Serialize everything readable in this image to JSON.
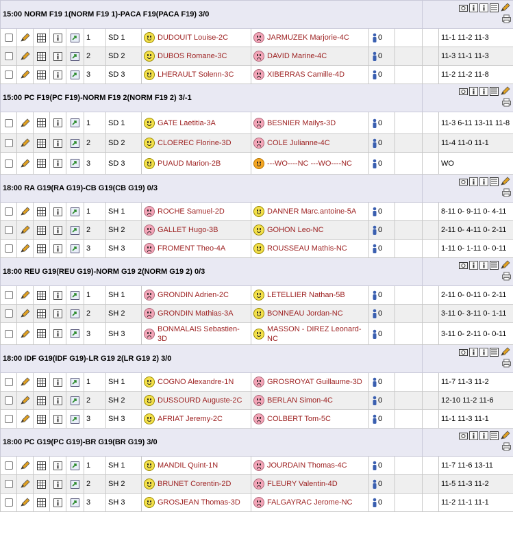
{
  "colors": {
    "header_bg": "#e9e9f3",
    "alt_row": "#efefef",
    "player_text": "#9c1f1f"
  },
  "icons": [
    "checkbox",
    "pencil-icon",
    "grid-icon",
    "info-icon",
    "export-icon",
    "happy-face-icon",
    "sad-face-icon",
    "umpire-icon",
    "stats-icon",
    "print-icon"
  ],
  "ties": [
    {
      "title": "15:00 NORM F19 1(NORM F19 1)-PACA F19(PACA F19)  3/0",
      "matches": [
        {
          "num": "1",
          "type": "SD 1",
          "p1": "DUDOUIT Louise-2C",
          "p1_face": "happy",
          "p2": "JARMUZEK Marjorie-4C",
          "p2_face": "sad",
          "ump": "0",
          "score": "11-1 11-2 11-3"
        },
        {
          "num": "2",
          "type": "SD 2",
          "p1": "DUBOS Romane-3C",
          "p1_face": "happy",
          "p2": "DAVID Marine-4C",
          "p2_face": "sad",
          "ump": "0",
          "score": "11-3 11-1 11-3"
        },
        {
          "num": "3",
          "type": "SD 3",
          "p1": "LHERAULT Solenn-3C",
          "p1_face": "happy",
          "p2": "XIBERRAS Camille-4D",
          "p2_face": "sad",
          "ump": "0",
          "score": "11-2 11-2 11-8"
        }
      ]
    },
    {
      "title": "15:00 PC F19(PC F19)-NORM F19 2(NORM F19 2)  3/-1",
      "matches": [
        {
          "num": "1",
          "type": "SD 1",
          "p1": "GATE Laetitia-3A",
          "p1_face": "happy",
          "p2": "BESNIER Mailys-3D",
          "p2_face": "sad",
          "ump": "0",
          "score": "11-3 6-11 13-11 11-8",
          "tall": true
        },
        {
          "num": "2",
          "type": "SD 2",
          "p1": "CLOEREC Florine-3D",
          "p1_face": "happy",
          "p2": "COLE Julianne-4C",
          "p2_face": "sad",
          "ump": "0",
          "score": "11-4 11-0 11-1"
        },
        {
          "num": "3",
          "type": "SD 3",
          "p1": "PUAUD Marion-2B",
          "p1_face": "happy",
          "p2": "---WO----NC ---WO----NC",
          "p2_face": "wo",
          "ump": "0",
          "score": "WO",
          "tall": true
        }
      ]
    },
    {
      "title": "18:00 RA G19(RA G19)-CB G19(CB G19)  0/3",
      "matches": [
        {
          "num": "1",
          "type": "SH 1",
          "p1": "ROCHE Samuel-2D",
          "p1_face": "sad",
          "p2": "DANNER Marc.antoine-5A",
          "p2_face": "happy",
          "ump": "0",
          "score": "8-11 0- 9-11 0- 4-11"
        },
        {
          "num": "2",
          "type": "SH 2",
          "p1": "GALLET Hugo-3B",
          "p1_face": "sad",
          "p2": "GOHON Leo-NC",
          "p2_face": "happy",
          "ump": "0",
          "score": "2-11 0- 4-11 0- 2-11"
        },
        {
          "num": "3",
          "type": "SH 3",
          "p1": "FROMENT Theo-4A",
          "p1_face": "sad",
          "p2": "ROUSSEAU Mathis-NC",
          "p2_face": "happy",
          "ump": "0",
          "score": "1-11 0- 1-11 0- 0-11"
        }
      ]
    },
    {
      "title": "18:00 REU G19(REU G19)-NORM G19 2(NORM G19 2)  0/3",
      "matches": [
        {
          "num": "1",
          "type": "SH 1",
          "p1": "GRONDIN Adrien-2C",
          "p1_face": "sad",
          "p2": "LETELLIER Nathan-5B",
          "p2_face": "happy",
          "ump": "0",
          "score": "2-11 0- 0-11 0- 2-11"
        },
        {
          "num": "2",
          "type": "SH 2",
          "p1": "GRONDIN Mathias-3A",
          "p1_face": "sad",
          "p2": "BONNEAU Jordan-NC",
          "p2_face": "happy",
          "ump": "0",
          "score": "3-11 0- 3-11 0- 1-11"
        },
        {
          "num": "3",
          "type": "SH 3",
          "p1": "BONMALAIS Sebastien-3D",
          "p1_face": "sad",
          "p2": "MASSON - DIREZ Leonard-NC",
          "p2_face": "happy",
          "ump": "0",
          "score": "3-11 0- 2-11 0- 0-11",
          "tall": true
        }
      ]
    },
    {
      "title": "18:00 IDF G19(IDF G19)-LR G19 2(LR G19 2)  3/0",
      "matches": [
        {
          "num": "1",
          "type": "SH 1",
          "p1": "COGNO Alexandre-1N",
          "p1_face": "happy",
          "p2": "GROSROYAT Guillaume-3D",
          "p2_face": "sad",
          "ump": "0",
          "score": "11-7 11-3 11-2"
        },
        {
          "num": "2",
          "type": "SH 2",
          "p1": "DUSSOURD Auguste-2C",
          "p1_face": "happy",
          "p2": "BERLAN Simon-4C",
          "p2_face": "sad",
          "ump": "0",
          "score": "12-10 11-2 11-6"
        },
        {
          "num": "3",
          "type": "SH 3",
          "p1": "AFRIAT Jeremy-2C",
          "p1_face": "happy",
          "p2": "COLBERT Tom-5C",
          "p2_face": "sad",
          "ump": "0",
          "score": "11-1 11-3 11-1"
        }
      ]
    },
    {
      "title": "18:00 PC G19(PC G19)-BR G19(BR G19)  3/0",
      "matches": [
        {
          "num": "1",
          "type": "SH 1",
          "p1": "MANDIL Quint-1N",
          "p1_face": "happy",
          "p2": "JOURDAIN Thomas-4C",
          "p2_face": "sad",
          "ump": "0",
          "score": "11-7 11-6 13-11"
        },
        {
          "num": "2",
          "type": "SH 2",
          "p1": "BRUNET Corentin-2D",
          "p1_face": "happy",
          "p2": "FLEURY Valentin-4D",
          "p2_face": "sad",
          "ump": "0",
          "score": "11-5 11-3 11-2"
        },
        {
          "num": "3",
          "type": "SH 3",
          "p1": "GROSJEAN Thomas-3D",
          "p1_face": "happy",
          "p2": "FALGAYRAC Jerome-NC",
          "p2_face": "sad",
          "ump": "0",
          "score": "11-2 11-1 11-1"
        }
      ]
    }
  ]
}
